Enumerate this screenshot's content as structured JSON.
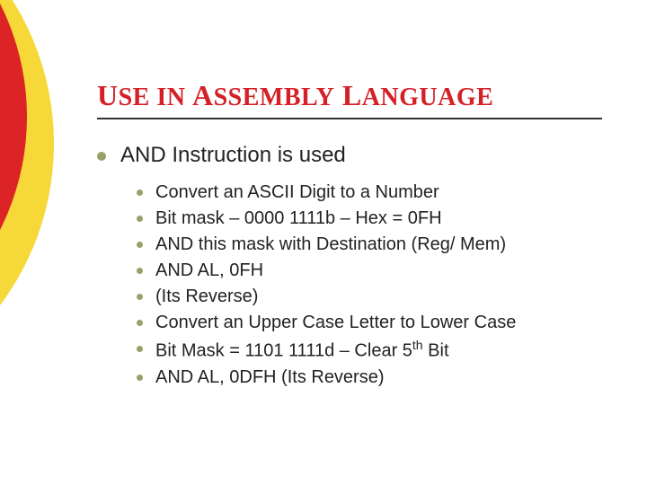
{
  "title": {
    "word1_cap": "U",
    "word1_rest": "SE",
    "word2_cap": " IN ",
    "word3_cap": "A",
    "word3_rest": "SSEMBLY",
    "word4_cap": " L",
    "word4_rest": "ANGUAGE"
  },
  "main_point": "AND Instruction is used",
  "sub_points": [
    "Convert an ASCII Digit to a Number",
    "Bit mask – 0000 1111b – Hex = 0FH",
    "AND this mask with Destination (Reg/ Mem)",
    "AND AL, 0FH",
    "(Its Reverse)",
    "Convert an Upper Case Letter to Lower Case",
    "Bit Mask = 1101 1111d – Clear 5th Bit",
    "AND AL, 0DFH (Its Reverse)"
  ]
}
